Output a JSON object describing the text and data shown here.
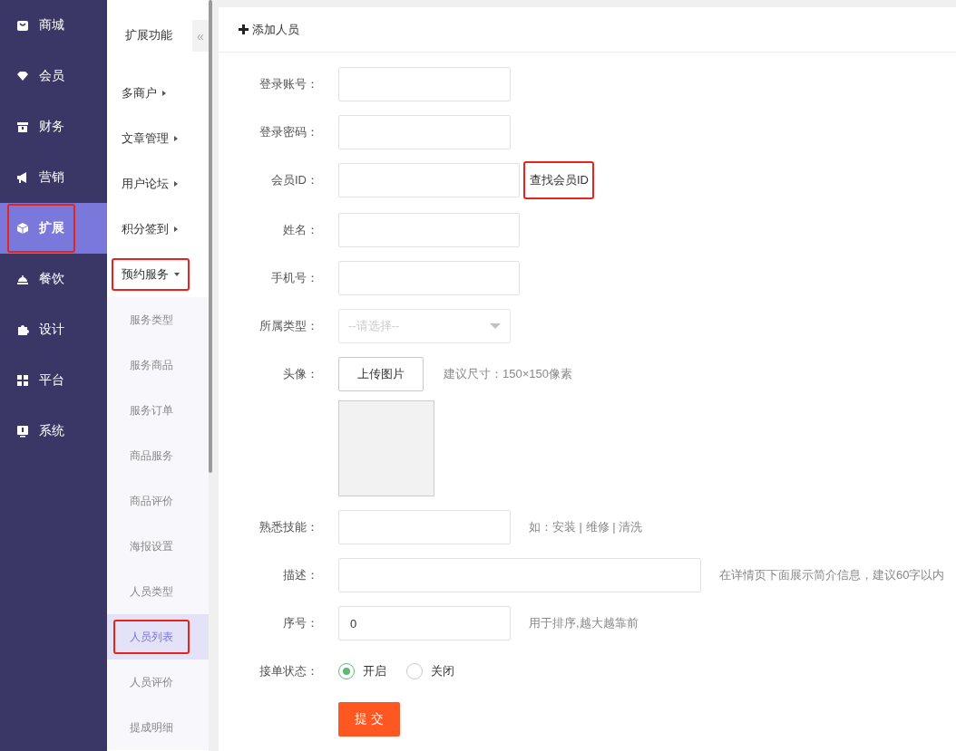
{
  "main_nav": {
    "items": [
      {
        "label": "商城",
        "kind": "bag",
        "selected": false,
        "highlighted": false
      },
      {
        "label": "会员",
        "kind": "gem",
        "selected": false,
        "highlighted": false
      },
      {
        "label": "财务",
        "kind": "box",
        "selected": false,
        "highlighted": false
      },
      {
        "label": "营销",
        "kind": "horn",
        "selected": false,
        "highlighted": false
      },
      {
        "label": "扩展",
        "kind": "cube",
        "selected": true,
        "highlighted": true
      },
      {
        "label": "餐饮",
        "kind": "cloche",
        "selected": false,
        "highlighted": false
      },
      {
        "label": "设计",
        "kind": "puzzle",
        "selected": false,
        "highlighted": false
      },
      {
        "label": "平台",
        "kind": "grid",
        "selected": false,
        "highlighted": false
      },
      {
        "label": "系统",
        "kind": "monitor",
        "selected": false,
        "highlighted": false
      }
    ]
  },
  "sub_nav": {
    "title": "扩展功能",
    "collapse": "«",
    "groups": [
      {
        "label": "多商户",
        "expanded": false,
        "highlighted": false
      },
      {
        "label": "文章管理",
        "expanded": false,
        "highlighted": false
      },
      {
        "label": "用户论坛",
        "expanded": false,
        "highlighted": false
      },
      {
        "label": "积分签到",
        "expanded": false,
        "highlighted": false
      },
      {
        "label": "预约服务",
        "expanded": true,
        "highlighted": true,
        "children": [
          {
            "label": "服务类型",
            "selected": false,
            "highlighted": false
          },
          {
            "label": "服务商品",
            "selected": false,
            "highlighted": false
          },
          {
            "label": "服务订单",
            "selected": false,
            "highlighted": false
          },
          {
            "label": "商品服务",
            "selected": false,
            "highlighted": false
          },
          {
            "label": "商品评价",
            "selected": false,
            "highlighted": false
          },
          {
            "label": "海报设置",
            "selected": false,
            "highlighted": false
          },
          {
            "label": "人员类型",
            "selected": false,
            "highlighted": false
          },
          {
            "label": "人员列表",
            "selected": true,
            "highlighted": true
          },
          {
            "label": "人员评价",
            "selected": false,
            "highlighted": false
          },
          {
            "label": "提成明细",
            "selected": false,
            "highlighted": false
          }
        ]
      }
    ]
  },
  "panel": {
    "title": "添加人员",
    "fields": [
      {
        "kind": "text",
        "label": "登录账号："
      },
      {
        "kind": "text",
        "label": "登录密码："
      },
      {
        "kind": "text",
        "label": "会员ID：",
        "link": {
          "label": "查找会员ID",
          "highlighted": true
        }
      },
      {
        "kind": "text",
        "label": "姓名："
      },
      {
        "kind": "text",
        "label": "手机号："
      },
      {
        "kind": "select",
        "label": "所属类型：",
        "placeholder": "--请选择--"
      },
      {
        "kind": "upload",
        "label": "头像：",
        "button": "上传图片",
        "hint": "建议尺寸：150×150像素"
      },
      {
        "kind": "text",
        "label": "熟悉技能：",
        "hint": "如：安装 | 维修 | 清洗"
      },
      {
        "kind": "wide_text",
        "label": "描述：",
        "hint": "在详情页下面展示简介信息，建议60字以内"
      },
      {
        "kind": "text",
        "label": "序号：",
        "value": "0",
        "hint": "用于排序,越大越靠前"
      },
      {
        "kind": "radio",
        "label": "接单状态：",
        "options": [
          {
            "label": "开启",
            "selected": true
          },
          {
            "label": "关闭",
            "selected": false
          }
        ]
      }
    ],
    "submit": "提 交"
  }
}
